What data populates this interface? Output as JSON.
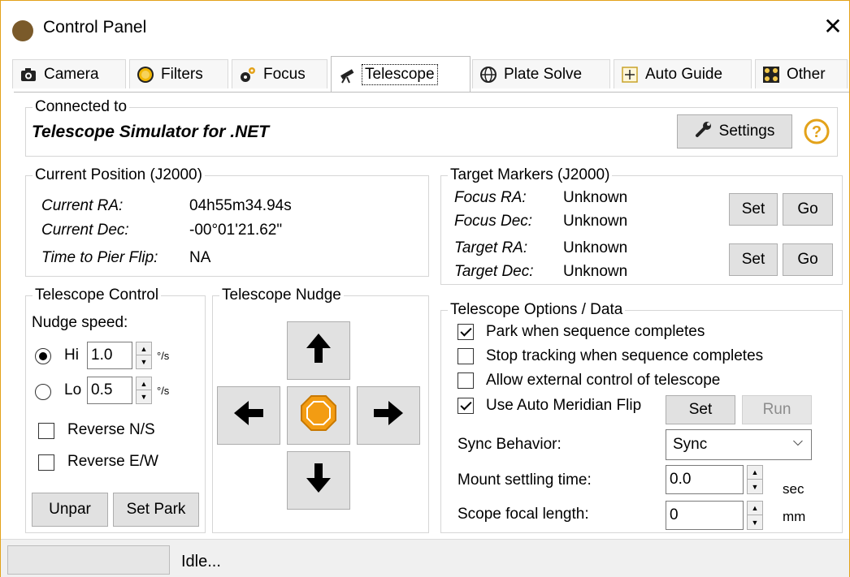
{
  "window": {
    "title": "Control Panel"
  },
  "tabs": [
    {
      "label": "Camera",
      "icon": "camera-icon"
    },
    {
      "label": "Filters",
      "icon": "filter-wheel-icon"
    },
    {
      "label": "Focus",
      "icon": "gears-icon"
    },
    {
      "label": "Telescope",
      "icon": "telescope-icon",
      "active": true
    },
    {
      "label": "Plate Solve",
      "icon": "globe-icon"
    },
    {
      "label": "Auto Guide",
      "icon": "crosshair-icon"
    },
    {
      "label": "Other",
      "icon": "grid-icon"
    }
  ],
  "connected": {
    "legend": "Connected to",
    "name": "Telescope Simulator for .NET",
    "settings_label": "Settings",
    "help_icon": "help-icon"
  },
  "current_position": {
    "legend": "Current Position (J2000)",
    "ra_label": "Current RA:",
    "ra_value": "04h55m34.94s",
    "dec_label": "Current Dec:",
    "dec_value": "-00°01'21.62\"",
    "flip_label": "Time to Pier Flip:",
    "flip_value": "NA"
  },
  "target_markers": {
    "legend": "Target Markers (J2000)",
    "focus_ra_label": "Focus RA:",
    "focus_ra_value": "Unknown",
    "focus_dec_label": "Focus Dec:",
    "focus_dec_value": "Unknown",
    "target_ra_label": "Target RA:",
    "target_ra_value": "Unknown",
    "target_dec_label": "Target Dec:",
    "target_dec_value": "Unknown",
    "set_label": "Set",
    "go_label": "Go"
  },
  "telescope_control": {
    "legend": "Telescope Control",
    "nudge_speed_label": "Nudge speed:",
    "hi_label": "Hi",
    "hi_value": "1.0",
    "lo_label": "Lo",
    "lo_value": "0.5",
    "unit": "°/s",
    "hi_selected": true,
    "reverse_ns_label": "Reverse N/S",
    "reverse_ew_label": "Reverse E/W",
    "unpark_label": "Unpar",
    "set_park_label": "Set Park"
  },
  "telescope_nudge": {
    "legend": "Telescope Nudge",
    "up_icon": "arrow-up-icon",
    "down_icon": "arrow-down-icon",
    "left_icon": "arrow-left-icon",
    "right_icon": "arrow-right-icon",
    "stop_icon": "stop-octagon-icon",
    "stop_color": "#f39c12"
  },
  "options": {
    "legend": "Telescope Options / Data",
    "park_label": "Park when sequence completes",
    "park_checked": true,
    "stop_tracking_label": "Stop tracking when sequence completes",
    "stop_tracking_checked": false,
    "external_label": "Allow external control of telescope",
    "external_checked": false,
    "meridian_label": "Use Auto Meridian Flip",
    "meridian_checked": true,
    "set_label": "Set",
    "run_label": "Run",
    "sync_label": "Sync Behavior:",
    "sync_value": "Sync",
    "settling_label": "Mount settling time:",
    "settling_value": "0.0",
    "settling_unit": "sec",
    "focal_label": "Scope focal length:",
    "focal_value": "0",
    "focal_unit": "mm"
  },
  "status": {
    "text": "Idle..."
  }
}
